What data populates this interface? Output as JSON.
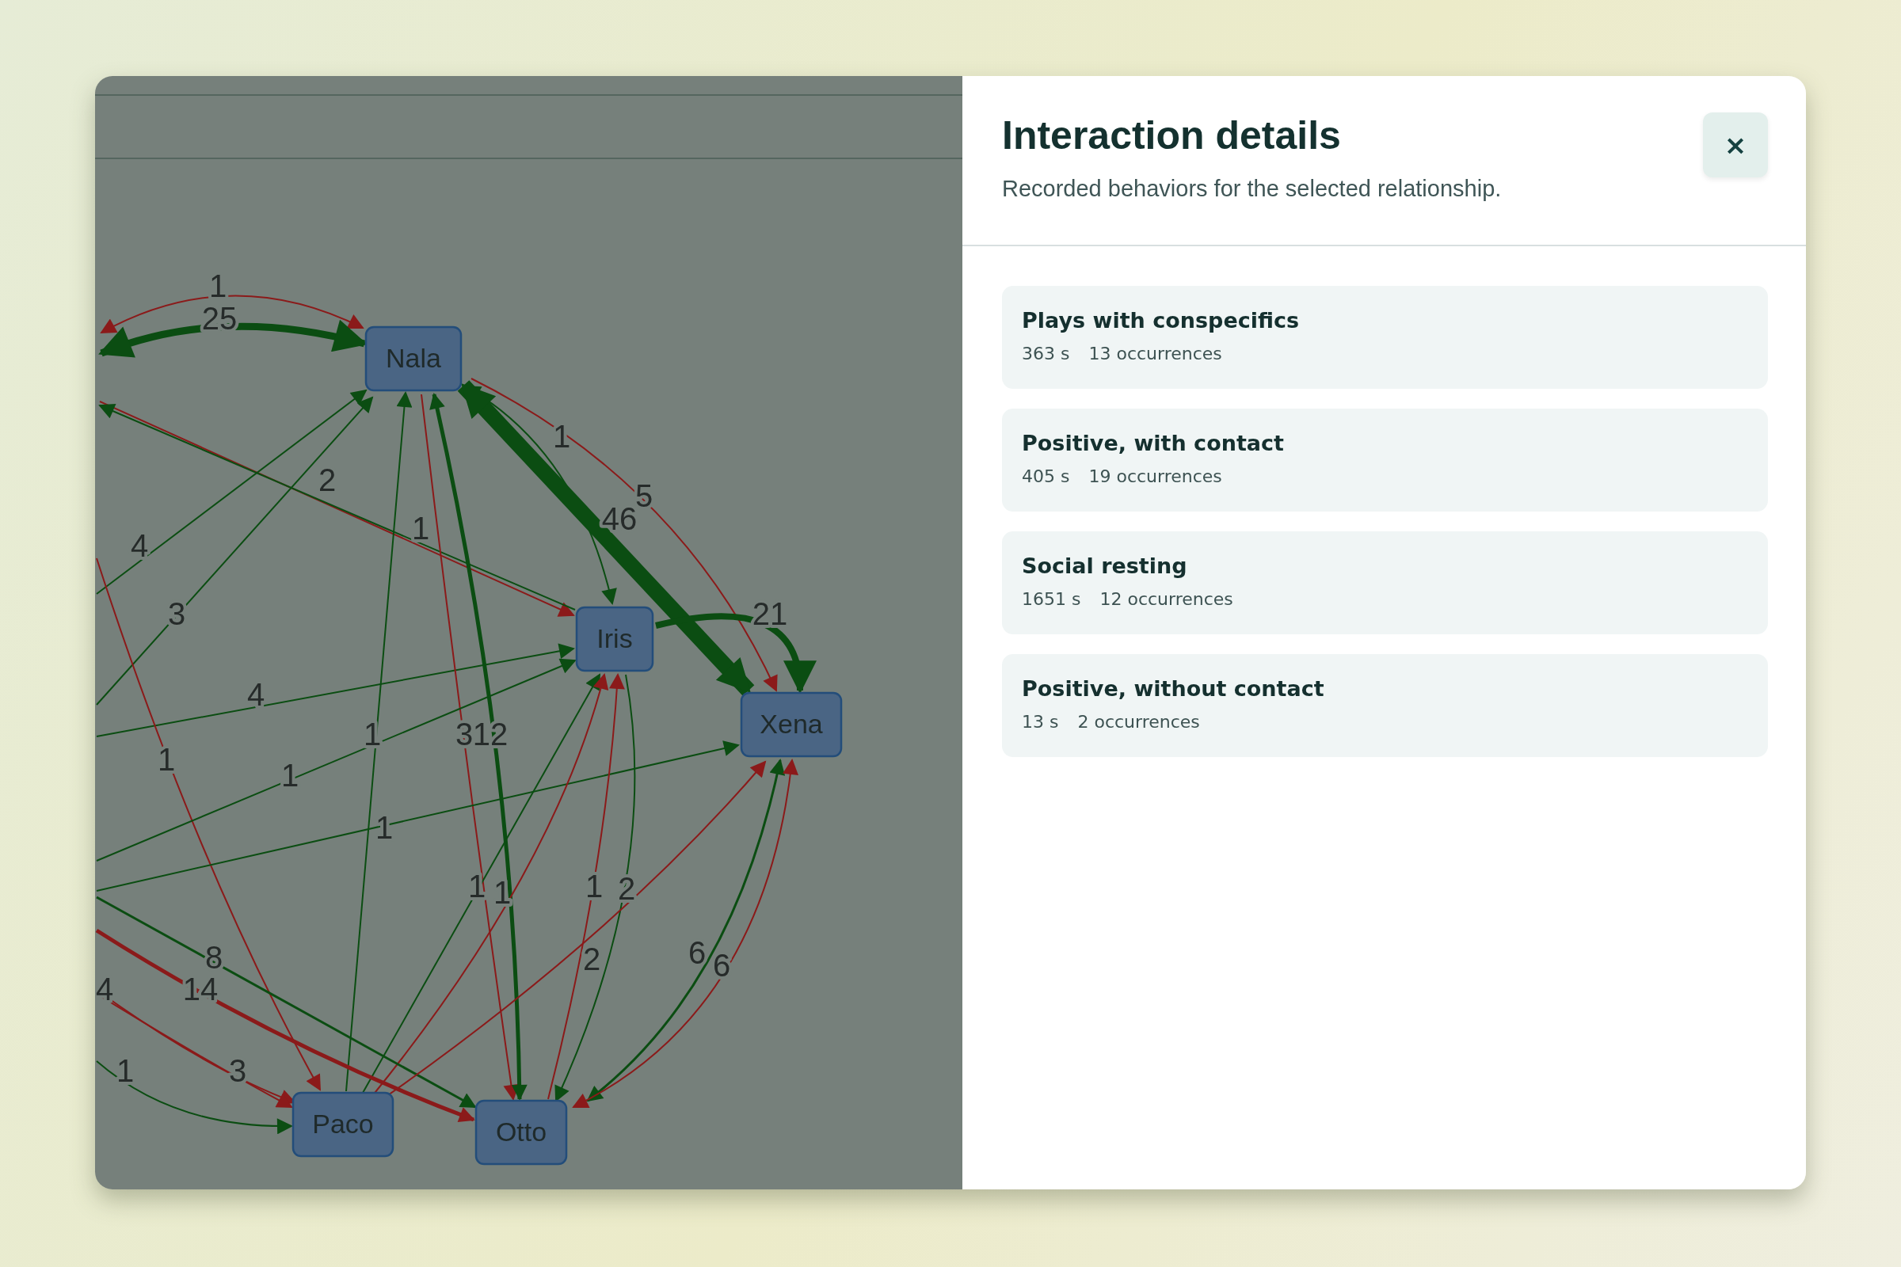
{
  "graph": {
    "nodes": [
      {
        "label": "Nala"
      },
      {
        "label": "Iris"
      },
      {
        "label": "Xena"
      },
      {
        "label": "Paco"
      },
      {
        "label": "Otto"
      }
    ],
    "edges": [
      {
        "label": "1",
        "kind": "negative"
      },
      {
        "label": "25",
        "kind": "positive"
      },
      {
        "label": "1",
        "kind": "positive"
      },
      {
        "label": "2",
        "kind": "negative"
      },
      {
        "label": "5",
        "kind": "negative"
      },
      {
        "label": "46",
        "kind": "positive"
      },
      {
        "label": "1",
        "kind": "positive"
      },
      {
        "label": "4",
        "kind": "positive"
      },
      {
        "label": "3",
        "kind": "positive"
      },
      {
        "label": "21",
        "kind": "positive"
      },
      {
        "label": "4",
        "kind": "positive"
      },
      {
        "label": "1",
        "kind": "positive"
      },
      {
        "label": "3",
        "kind": "negative"
      },
      {
        "label": "12",
        "kind": "positive"
      },
      {
        "label": "1",
        "kind": "negative"
      },
      {
        "label": "1",
        "kind": "positive"
      },
      {
        "label": "1",
        "kind": "positive"
      },
      {
        "label": "1",
        "kind": "positive"
      },
      {
        "label": "1",
        "kind": "negative"
      },
      {
        "label": "1",
        "kind": "negative"
      },
      {
        "label": "2",
        "kind": "positive"
      },
      {
        "label": "8",
        "kind": "positive"
      },
      {
        "label": "2",
        "kind": "negative"
      },
      {
        "label": "6",
        "kind": "positive"
      },
      {
        "label": "6",
        "kind": "negative"
      },
      {
        "label": "4",
        "kind": "negative"
      },
      {
        "label": "14",
        "kind": "negative"
      },
      {
        "label": "1",
        "kind": "positive"
      },
      {
        "label": "3",
        "kind": "negative"
      }
    ]
  },
  "drawer": {
    "title": "Interaction details",
    "subtitle": "Recorded behaviors for the selected relationship.",
    "close": "×",
    "behaviors": [
      {
        "name": "Plays with conspecifics",
        "duration": "363 s",
        "occurrences": "13 occurrences"
      },
      {
        "name": "Positive, with contact",
        "duration": "405 s",
        "occurrences": "19 occurrences"
      },
      {
        "name": "Social resting",
        "duration": "1651 s",
        "occurrences": "12 occurrences"
      },
      {
        "name": "Positive, without contact",
        "duration": "13 s",
        "occurrences": "2 occurrences"
      }
    ]
  }
}
